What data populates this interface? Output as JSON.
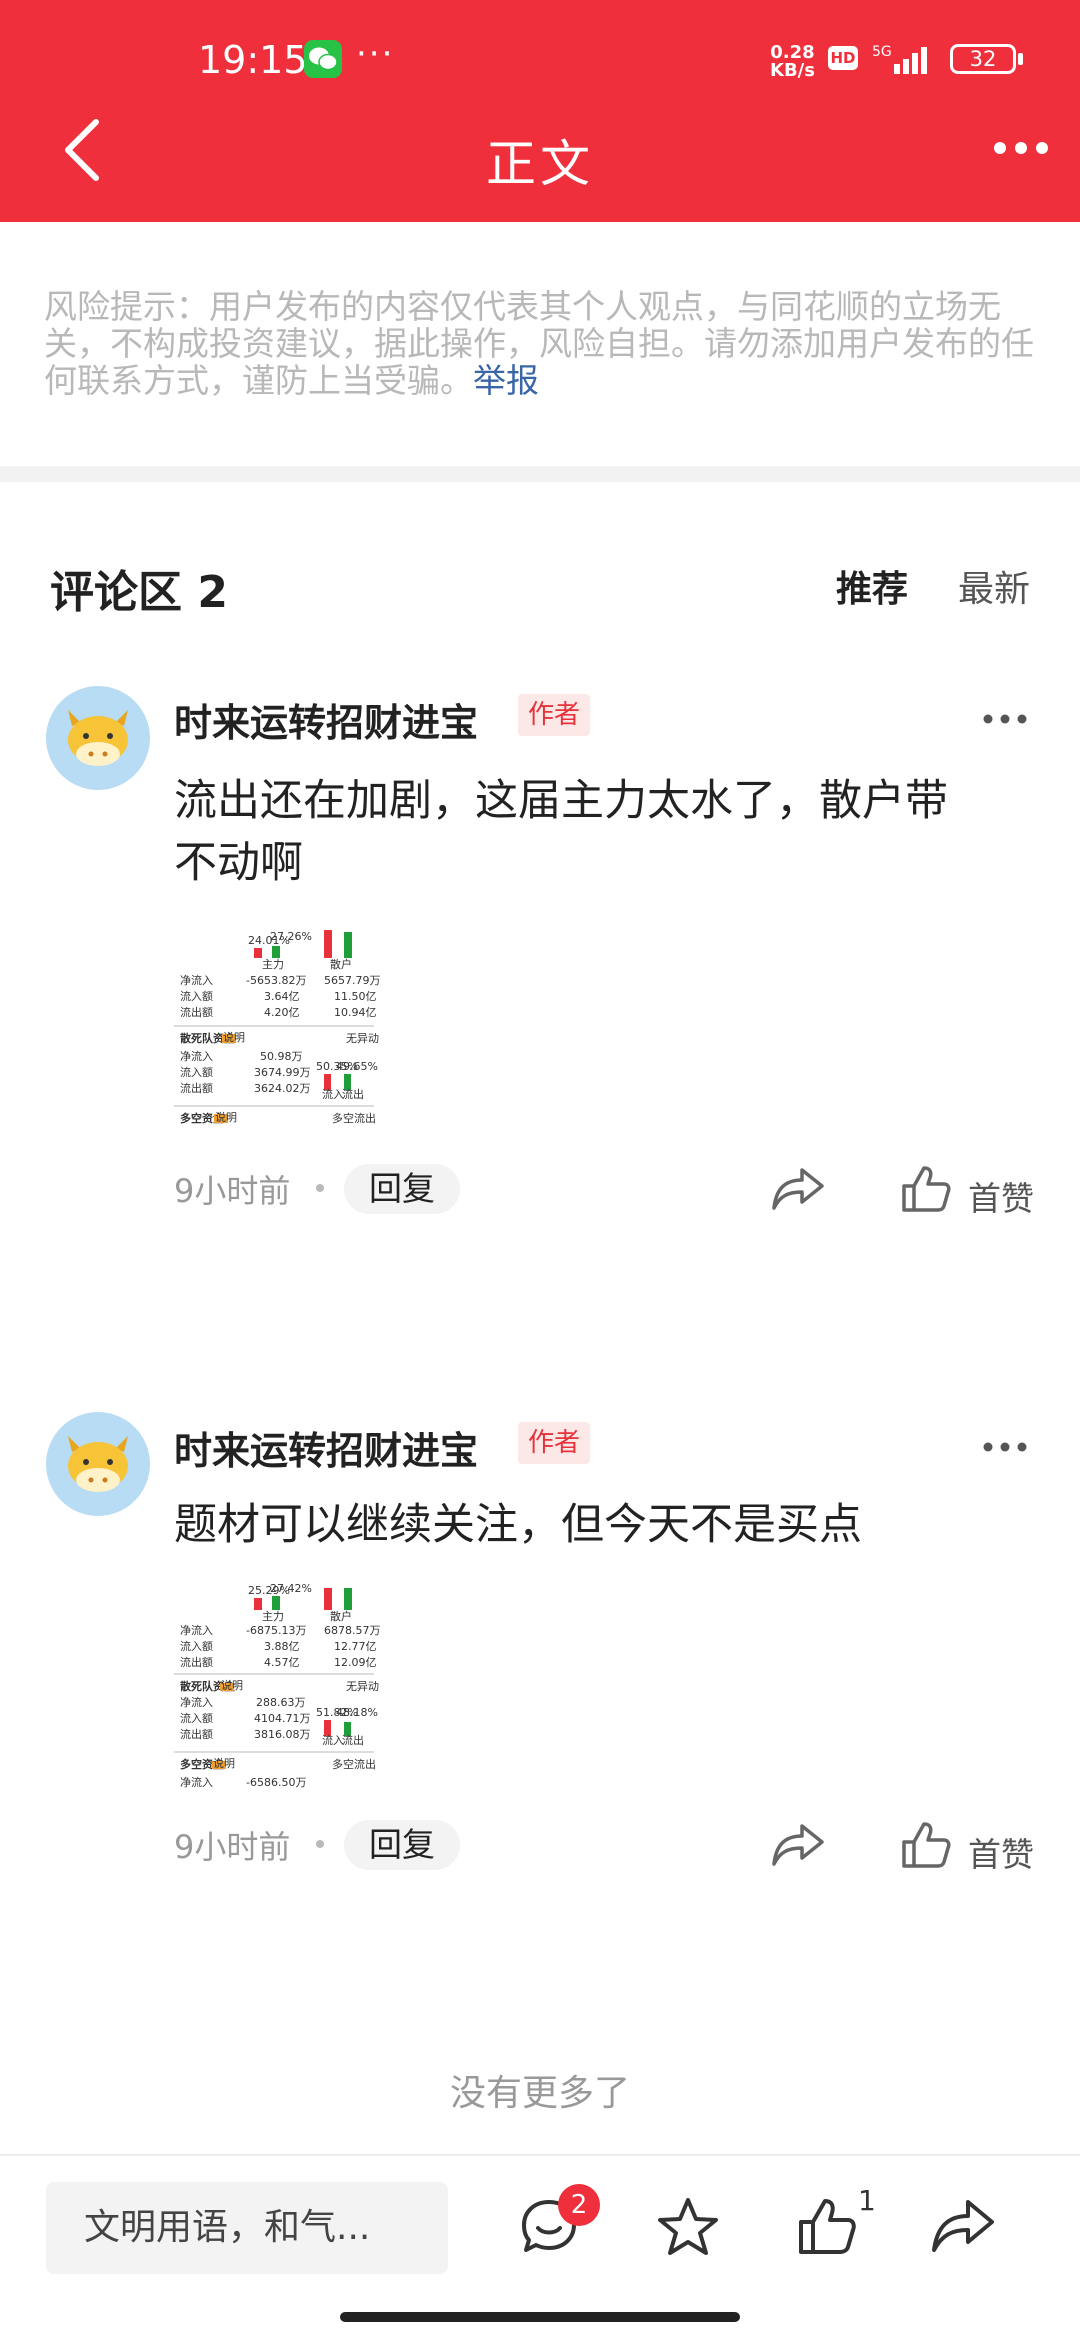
{
  "status_bar": {
    "time": "19:15",
    "dots": "···",
    "speed_value": "0.28",
    "speed_unit": "KB/s",
    "hd": "HD",
    "network": "5G",
    "battery": "32"
  },
  "header": {
    "title": "正文"
  },
  "risk_notice": {
    "text": "风险提示：用户发布的内容仅代表其个人观点，与同花顺的立场无关，不构成投资建议，据此操作，风险自担。请勿添加用户发布的任何联系方式，谨防上当受骗。",
    "report_link": "举报"
  },
  "comments_section": {
    "title": "评论区 2",
    "sort_recommended": "推荐",
    "sort_latest": "最新"
  },
  "comments": [
    {
      "username": "时来运转招财进宝",
      "author_tag": "作者",
      "text_line1": "流出还在加剧，这届主力太水了，散户带",
      "text_line2": "不动啊",
      "time": "9小时前",
      "reply_label": "回复",
      "like_label": "首赞",
      "image": {
        "main_in_pct": "24.01%",
        "main_out_pct": "27.26%",
        "main_label": "主力",
        "retail_label": "散户",
        "rows": [
          {
            "label": "净流入",
            "v1": "-5653.82万",
            "v2": "5657.79万"
          },
          {
            "label": "流入额",
            "v1": "3.64亿",
            "v2": "11.50亿"
          },
          {
            "label": "流出额",
            "v1": "4.20亿",
            "v2": "10.94亿"
          }
        ],
        "section2": "散死队资金",
        "section2_tag": "说明",
        "section2_right": "无异动",
        "rows2": [
          {
            "label": "净流入",
            "v1": "50.98万"
          },
          {
            "label": "流入额",
            "v1": "3674.99万"
          },
          {
            "label": "流出额",
            "v1": "3624.02万"
          }
        ],
        "in_pct2": "50.35%",
        "out_pct2": "49.65%",
        "in_label": "流入",
        "out_label": "流出",
        "section3": "多空资金",
        "section3_tag": "说明",
        "section3_right": "多空流出"
      }
    },
    {
      "username": "时来运转招财进宝",
      "author_tag": "作者",
      "text_line1": "题材可以继续关注，但今天不是买点",
      "time": "9小时前",
      "reply_label": "回复",
      "like_label": "首赞",
      "image": {
        "main_in_pct": "25.29%",
        "main_out_pct": "27.42%",
        "main_label": "主力",
        "retail_label": "散户",
        "rows": [
          {
            "label": "净流入",
            "v1": "-6875.13万",
            "v2": "6878.57万"
          },
          {
            "label": "流入额",
            "v1": "3.88亿",
            "v2": "12.77亿"
          },
          {
            "label": "流出额",
            "v1": "4.57亿",
            "v2": "12.09亿"
          }
        ],
        "section2": "散死队资金",
        "section2_tag": "说明",
        "section2_right": "无异动",
        "rows2": [
          {
            "label": "净流入",
            "v1": "288.63万"
          },
          {
            "label": "流入额",
            "v1": "4104.71万"
          },
          {
            "label": "流出额",
            "v1": "3816.08万"
          }
        ],
        "in_pct2": "51.82%",
        "out_pct2": "48.18%",
        "in_label": "流入",
        "out_label": "流出",
        "section3": "多空资金",
        "section3_tag": "说明",
        "section3_right": "多空流出",
        "row3_label": "净流入",
        "row3_value": "-6586.50万"
      }
    }
  ],
  "no_more": "没有更多了",
  "bottom_bar": {
    "input_placeholder": "文明用语，和气...",
    "comment_badge": "2",
    "like_count": "1"
  },
  "colors": {
    "brand_red": "#ef2f3b",
    "rise_red": "#e8313a",
    "fall_green": "#1f9e3a",
    "link_blue": "#3a66a8"
  }
}
